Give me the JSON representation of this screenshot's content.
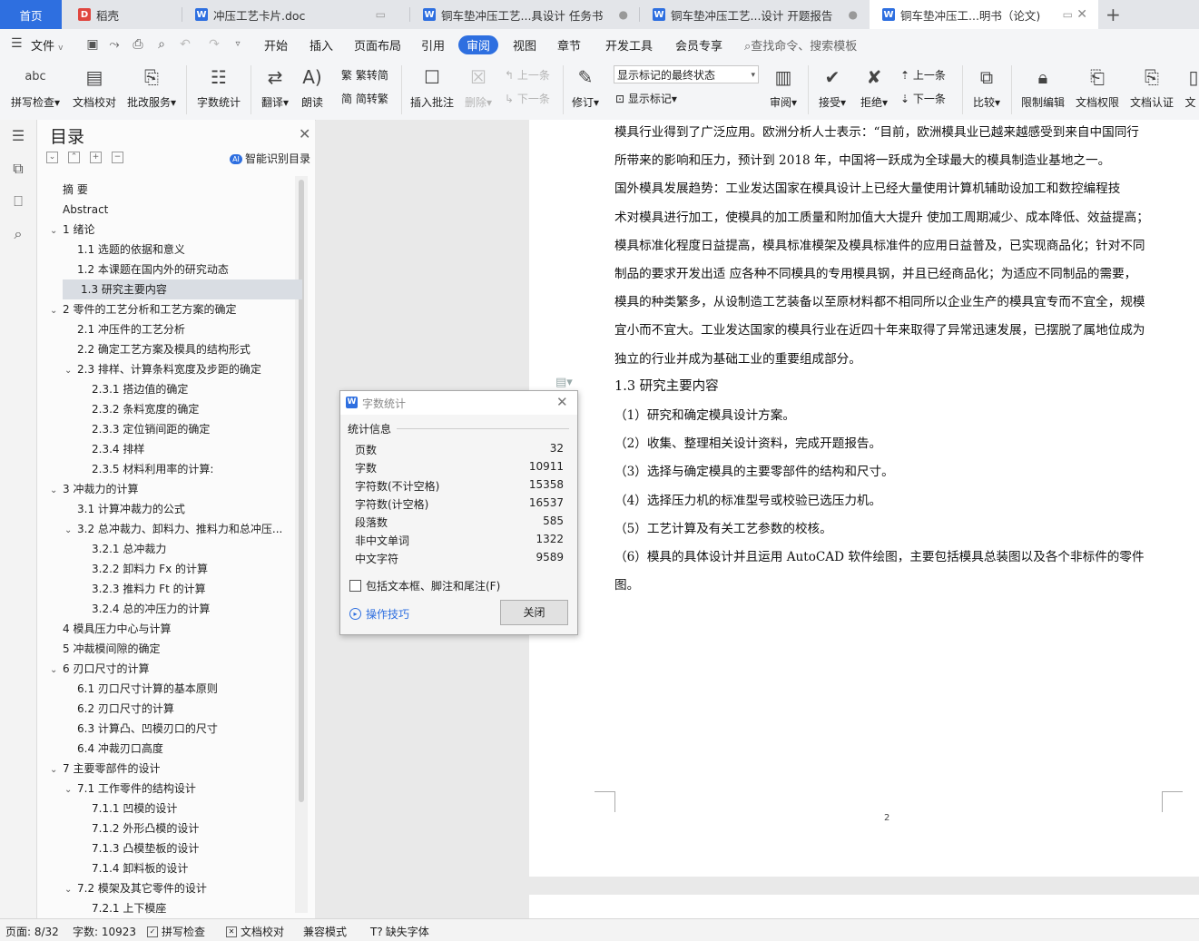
{
  "tabs": {
    "home": "首页",
    "items": [
      {
        "label": "稻壳",
        "color": "#e0463f"
      },
      {
        "label": "冲压工艺卡片.doc",
        "color": "#2e6fe0"
      },
      {
        "label": "铜车垫冲压工艺...具设计 任务书",
        "color": "#2e6fe0"
      },
      {
        "label": "铜车垫冲压工艺...设计 开题报告",
        "color": "#2e6fe0"
      },
      {
        "label": "铜车垫冲压工...明书（论文)",
        "color": "#2e6fe0"
      }
    ],
    "new_tab": "+"
  },
  "menu": {
    "file": "文件",
    "items": [
      "开始",
      "插入",
      "页面布局",
      "引用",
      "审阅",
      "视图",
      "章节",
      "开发工具",
      "会员专享"
    ],
    "active": "审阅",
    "search": "查找命令、搜索模板"
  },
  "ribbon": {
    "spell_check": "拼写检查",
    "doc_proof": "文档校对",
    "annotate_service": "批改服务",
    "word_count": "字数统计",
    "translate": "翻译",
    "read_aloud": "朗读",
    "trad_to_simp": "繁转简",
    "simp_to_trad": "简转繁",
    "insert_comment": "插入批注",
    "delete": "删除",
    "prev_comment": "上一条",
    "next_comment": "下一条",
    "revise": "修订",
    "markup_select": "显示标记的最终状态",
    "show_markup": "显示标记",
    "review": "审阅",
    "accept": "接受",
    "reject": "拒绝",
    "prev_change": "上一条",
    "next_change": "下一条",
    "compare": "比较",
    "restrict_edit": "限制编辑",
    "doc_permission": "文档权限",
    "doc_auth": "文档认证",
    "doc_more": "文"
  },
  "toc": {
    "title": "目录",
    "smart": "智能识别目录",
    "items": [
      {
        "label": "摘  要",
        "level": 0,
        "arrow": ""
      },
      {
        "label": "Abstract",
        "level": 0,
        "arrow": ""
      },
      {
        "label": "1  绪论",
        "level": 0,
        "arrow": "v"
      },
      {
        "label": "1.1  选题的依据和意义",
        "level": 1,
        "arrow": ""
      },
      {
        "label": "1.2  本课题在国内外的研究动态",
        "level": 1,
        "arrow": ""
      },
      {
        "label": "1.3  研究主要内容",
        "level": 1,
        "arrow": "",
        "selected": true
      },
      {
        "label": "2  零件的工艺分析和工艺方案的确定",
        "level": 0,
        "arrow": "v"
      },
      {
        "label": "2.1  冲压件的工艺分析",
        "level": 1,
        "arrow": ""
      },
      {
        "label": "2.2  确定工艺方案及模具的结构形式",
        "level": 1,
        "arrow": ""
      },
      {
        "label": "2.3  排样、计算条料宽度及步距的确定",
        "level": 1,
        "arrow": "v"
      },
      {
        "label": "2.3.1  搭边值的确定",
        "level": 2,
        "arrow": ""
      },
      {
        "label": "2.3.2  条料宽度的确定",
        "level": 2,
        "arrow": ""
      },
      {
        "label": "2.3.3  定位销间距的确定",
        "level": 2,
        "arrow": ""
      },
      {
        "label": "2.3.4  排样",
        "level": 2,
        "arrow": ""
      },
      {
        "label": "2.3.5  材料利用率的计算:",
        "level": 2,
        "arrow": ""
      },
      {
        "label": "3  冲裁力的计算",
        "level": 0,
        "arrow": "v"
      },
      {
        "label": "3.1  计算冲裁力的公式",
        "level": 1,
        "arrow": ""
      },
      {
        "label": "3.2  总冲裁力、卸料力、推料力和总冲压...",
        "level": 1,
        "arrow": "v"
      },
      {
        "label": "3.2.1  总冲裁力",
        "level": 2,
        "arrow": ""
      },
      {
        "label": "3.2.2  卸料力 Fx 的计算",
        "level": 2,
        "arrow": ""
      },
      {
        "label": "3.2.3  推料力 Ft 的计算",
        "level": 2,
        "arrow": ""
      },
      {
        "label": "3.2.4  总的冲压力的计算",
        "level": 2,
        "arrow": ""
      },
      {
        "label": "4  模具压力中心与计算",
        "level": 0,
        "arrow": ""
      },
      {
        "label": "5  冲裁模间隙的确定",
        "level": 0,
        "arrow": ""
      },
      {
        "label": "6  刃口尺寸的计算",
        "level": 0,
        "arrow": "v"
      },
      {
        "label": "6.1  刃口尺寸计算的基本原则",
        "level": 1,
        "arrow": ""
      },
      {
        "label": "6.2  刃口尺寸的计算",
        "level": 1,
        "arrow": ""
      },
      {
        "label": "6.3  计算凸、凹模刃口的尺寸",
        "level": 1,
        "arrow": ""
      },
      {
        "label": "6.4  冲裁刃口高度",
        "level": 1,
        "arrow": ""
      },
      {
        "label": "7  主要零部件的设计",
        "level": 0,
        "arrow": "v"
      },
      {
        "label": "7.1  工作零件的结构设计",
        "level": 1,
        "arrow": "v"
      },
      {
        "label": "7.1.1  凹模的设计",
        "level": 2,
        "arrow": ""
      },
      {
        "label": "7.1.2  外形凸模的设计",
        "level": 2,
        "arrow": ""
      },
      {
        "label": "7.1.3  凸模垫板的设计",
        "level": 2,
        "arrow": ""
      },
      {
        "label": "7.1.4  卸料板的设计",
        "level": 2,
        "arrow": ""
      },
      {
        "label": "7.2  模架及其它零件的设计",
        "level": 1,
        "arrow": "v"
      },
      {
        "label": "7.2.1  上下模座",
        "level": 2,
        "arrow": ""
      }
    ]
  },
  "doc": {
    "lines": [
      "模具行业得到了广泛应用。欧洲分析人士表示：“目前，欧洲模具业已越来越感受到来自中国同行",
      "所带来的影响和压力，预计到 2018 年，中国将一跃成为全球最大的模具制造业基地之一。",
      "    国外模具发展趋势：工业发达国家在模具设计上已经大量使用计算机辅助设加工和数控编程技",
      "术对模具进行加工，使模具的加工质量和附加值大大提升  使加工周期减少、成本降低、效益提高；",
      "模具标准化程度日益提高，模具标准模架及模具标准件的应用日益普及，已实现商品化；针对不同",
      "制品的要求开发出适  应各种不同模具的专用模具钢，并且已经商品化；为适应不同制品的需要，",
      "模具的种类繁多，从设制造工艺装备以至原材料都不相同所以企业生产的模具宜专而不宜全，规模",
      "宜小而不宜大。工业发达国家的模具行业在近四十年来取得了异常迅速发展，已摆脱了属地位成为",
      "独立的行业并成为基础工业的重要组成部分。"
    ],
    "heading": "1.3  研究主要内容",
    "items": [
      "（1）研究和确定模具设计方案。",
      "（2）收集、整理相关设计资料，完成开题报告。",
      "（3）选择与确定模具的主要零部件的结构和尺寸。",
      "（4）选择压力机的标准型号或校验已选压力机。",
      "（5）工艺计算及有关工艺参数的校核。",
      "（6）模具的具体设计并且运用 AutoCAD 软件绘图，主要包括模具总装图以及各个非标件的零件",
      "图。"
    ],
    "page_number": "2"
  },
  "dialog": {
    "title": "字数统计",
    "group": "统计信息",
    "rows": [
      {
        "label": "页数",
        "value": "32"
      },
      {
        "label": "字数",
        "value": "10911"
      },
      {
        "label": "字符数(不计空格)",
        "value": "15358"
      },
      {
        "label": "字符数(计空格)",
        "value": "16537"
      },
      {
        "label": "段落数",
        "value": "585"
      },
      {
        "label": "非中文单词",
        "value": "1322"
      },
      {
        "label": "中文字符",
        "value": "9589"
      }
    ],
    "include_label": "包括文本框、脚注和尾注(F)",
    "tips": "操作技巧",
    "close": "关闭"
  },
  "status": {
    "page": "页面: 8/32",
    "words": "字数: 10923",
    "spell": "拼写检查",
    "proof": "文档校对",
    "compat": "兼容模式",
    "missing_font": "缺失字体"
  }
}
